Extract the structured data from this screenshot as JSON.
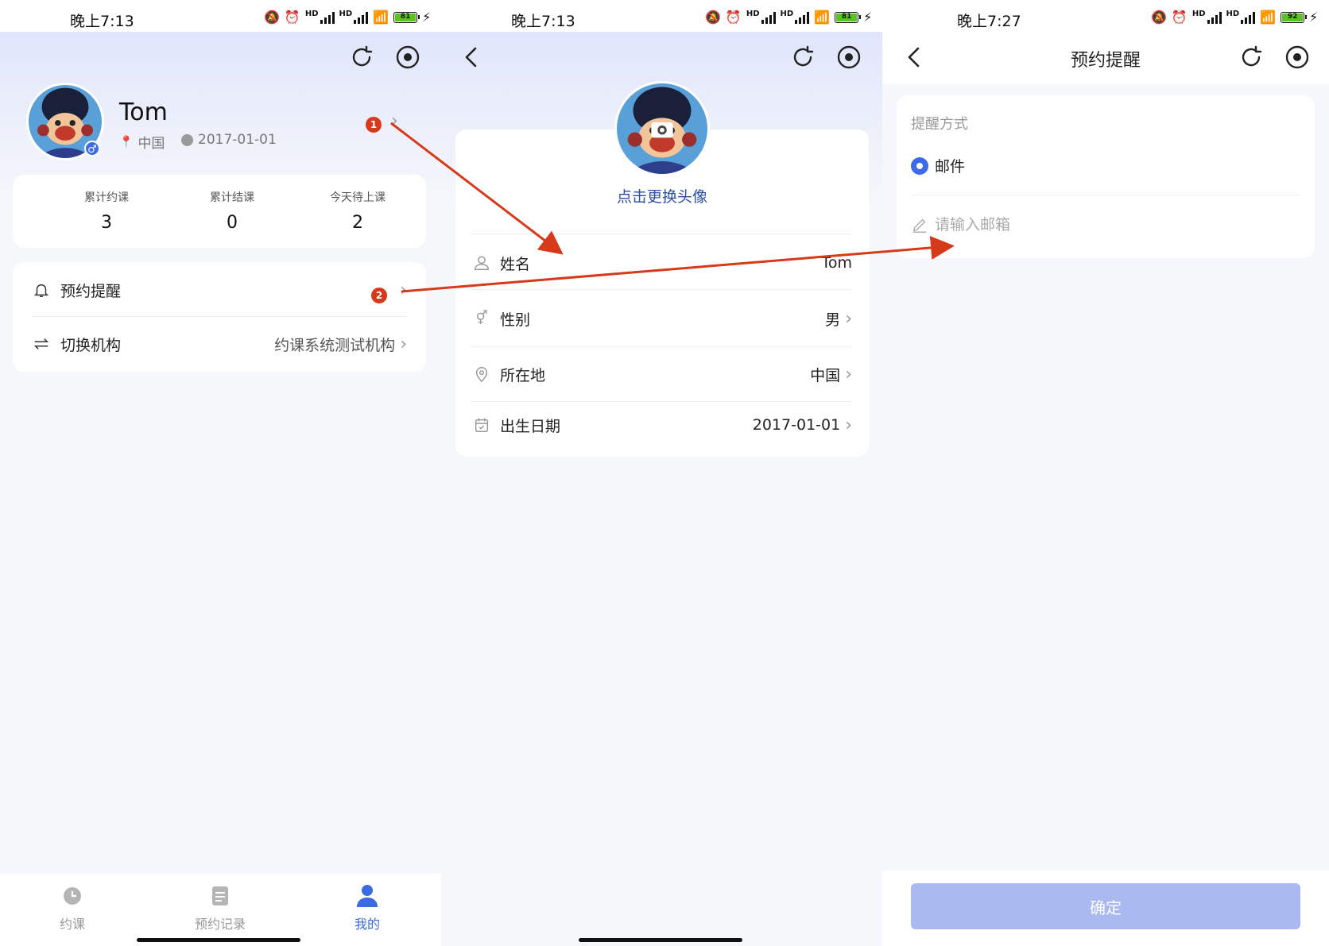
{
  "status": {
    "s1_time": "晚上7:13",
    "s2_time": "晚上7:13",
    "s3_time": "晚上7:27",
    "s1_battery": "81",
    "s2_battery": "81",
    "s3_battery": "92",
    "hd": "HD"
  },
  "profile": {
    "name": "Tom",
    "location": "中国",
    "birthday": "2017-01-01",
    "gender_symbol": "♂"
  },
  "stats": [
    {
      "label": "累计约课",
      "value": "3"
    },
    {
      "label": "累计结课",
      "value": "0"
    },
    {
      "label": "今天待上课",
      "value": "2"
    }
  ],
  "menu": {
    "reminder": "预约提醒",
    "switch_org": "切换机构",
    "org_value": "约课系统测试机构"
  },
  "tabs": [
    {
      "label": "约课",
      "icon": "alarm-clock-icon"
    },
    {
      "label": "预约记录",
      "icon": "clipboard-icon"
    },
    {
      "label": "我的",
      "icon": "user-icon"
    }
  ],
  "edit": {
    "change_avatar": "点击更换头像",
    "rows": [
      {
        "label": "姓名",
        "value": "Tom"
      },
      {
        "label": "性别",
        "value": "男"
      },
      {
        "label": "所在地",
        "value": "中国"
      },
      {
        "label": "出生日期",
        "value": "2017-01-01"
      }
    ]
  },
  "reminder_page": {
    "title": "预约提醒",
    "section": "提醒方式",
    "option": "邮件",
    "email_placeholder": "请输入邮箱",
    "confirm": "确定"
  },
  "annotations": {
    "badge1": "1",
    "badge2": "2"
  },
  "colors": {
    "accent": "#3d6be8",
    "annotation": "#d63a1a",
    "confirm_disabled": "#aab9f0"
  }
}
